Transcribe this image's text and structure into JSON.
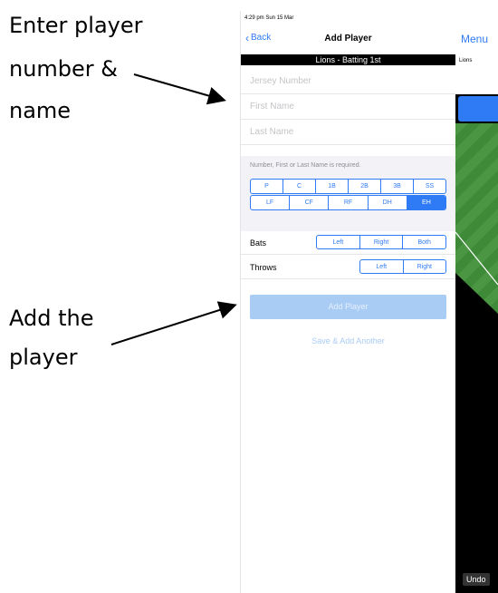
{
  "annotations": {
    "enter_line1": "Enter player",
    "enter_line2": "number &",
    "enter_line3": "name",
    "add_line1": "Add the",
    "add_line2": "player"
  },
  "status_bar": {
    "time": "4:29 pm  Sun 15 Mar"
  },
  "nav": {
    "back_label": "Back",
    "title": "Add Player"
  },
  "team_bar": "Lions - Batting 1st",
  "fields": {
    "jersey_placeholder": "Jersey Number",
    "first_placeholder": "First Name",
    "last_placeholder": "Last Name"
  },
  "hint": "Number, First or Last Name is required.",
  "positions_row1": [
    "P",
    "C",
    "1B",
    "2B",
    "3B",
    "SS"
  ],
  "positions_row2": [
    "LF",
    "CF",
    "RF",
    "DH",
    "EH"
  ],
  "selected_position": "EH",
  "bats": {
    "label": "Bats",
    "options": [
      "Left",
      "Right",
      "Both"
    ]
  },
  "throws": {
    "label": "Throws",
    "options": [
      "Left",
      "Right"
    ]
  },
  "add_button": "Add Player",
  "save_add_another": "Save & Add Another",
  "right_panel": {
    "menu": "Menu",
    "team": "Lions",
    "undo": "Undo"
  },
  "colors": {
    "accent": "#2f7bf5",
    "disabled_button": "#a9ccf5",
    "field_green": "#3f8a38"
  }
}
